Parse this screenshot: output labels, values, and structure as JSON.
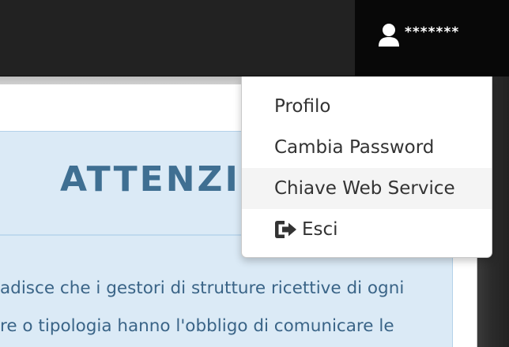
{
  "header": {
    "username": "*******",
    "user_icon": "user-icon"
  },
  "notice": {
    "title": "ATTENZIO",
    "lines": [
      "adisce che i gestori di strutture ricettive di ogni",
      "re o tipologia hanno l'obbligo di comunicare le"
    ]
  },
  "user_menu": {
    "items": [
      {
        "label": "Profilo"
      },
      {
        "label": "Cambia Password"
      },
      {
        "label": "Chiave Web Service",
        "highlighted": true
      },
      {
        "label": "Esci",
        "icon": "logout-icon"
      }
    ]
  },
  "colors": {
    "topbar": "#222222",
    "user_toggle": "#080808",
    "notice_bg": "#dbeaf6",
    "notice_title": "#3f6f92",
    "notice_text": "#3a6487",
    "menu_text": "#333333"
  }
}
